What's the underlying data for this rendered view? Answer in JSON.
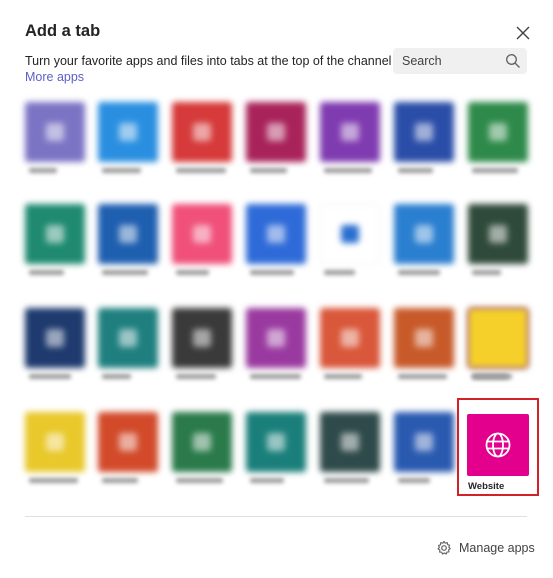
{
  "dialog": {
    "title": "Add a tab",
    "subtitle": "Turn your favorite apps and files into tabs at the top of the channel",
    "more_apps_label": "More apps",
    "close_icon": "close-icon"
  },
  "search": {
    "placeholder": "Search",
    "icon": "search-icon"
  },
  "highlighted_app": {
    "label": "Website",
    "color": "#e3008c",
    "icon": "globe-icon",
    "highlight_color": "#d1222a"
  },
  "footer": {
    "manage_apps_label": "Manage apps",
    "icon": "gear-icon"
  },
  "blurred_app_colors": [
    [
      "#7b74c4",
      "#2a8fe0",
      "#d63a3a",
      "#a8235a",
      "#7f3bb0",
      "#2a4ea8",
      "#2e8a4a"
    ],
    [
      "#1f8a70",
      "#1f5fb0",
      "#f0507a",
      "#2f6bd8",
      "#ffffff",
      "#2a7fd0",
      "#2f4a3a"
    ],
    [
      "#1e3a6e",
      "#1f7f7f",
      "#3a3a3a",
      "#9a3aa0",
      "#d9573a",
      "#c85a2a",
      "#8a3ab0"
    ],
    [
      "#e8c82a",
      "#d24a2a",
      "#2a7a4a",
      "#1a7f7a",
      "#2f4a4a",
      "#2a5ab0"
    ]
  ],
  "corner_tile_color": "#f5d02a"
}
